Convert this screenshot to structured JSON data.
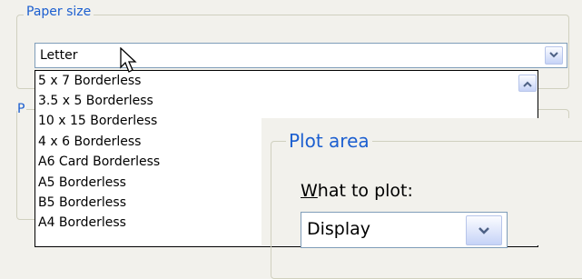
{
  "paper_size": {
    "legend": "Paper size",
    "selected": "Letter",
    "options": [
      "5 x 7 Borderless",
      "3.5 x 5 Borderless",
      "10 x 15 Borderless",
      "4 x 6 Borderless",
      "A6 Card Borderless",
      "A5 Borderless",
      "B5 Borderless",
      "A4 Borderless"
    ]
  },
  "plot_area": {
    "legend": "Plot area",
    "what_to_plot_label": "What to plot:",
    "selected": "Display"
  },
  "icons": {
    "dropdown": "chevron-down-icon",
    "scroll_up": "chevron-up-icon",
    "cursor": "mouse-pointer-icon"
  },
  "colors": {
    "legend_text": "#1c5fd0",
    "window_bg": "#f2f1ec",
    "group_border": "#d0d0bf"
  }
}
